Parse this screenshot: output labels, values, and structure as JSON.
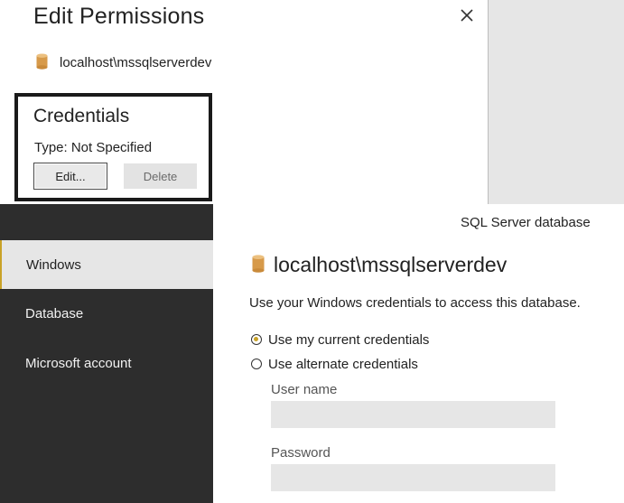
{
  "permissions_dialog": {
    "title": "Edit Permissions",
    "close_icon": "close-icon",
    "source_icon": "database-cylinder-icon",
    "source": "localhost\\mssqlserverdev",
    "credentials": {
      "heading": "Credentials",
      "type_text": "Type: Not Specified",
      "edit_label": "Edit...",
      "delete_label": "Delete"
    }
  },
  "credentials_dialog": {
    "connection_type": "SQL Server database",
    "source_icon": "database-cylinder-icon",
    "source": "localhost\\mssqlserverdev",
    "nav": [
      {
        "label": "Windows",
        "selected": true
      },
      {
        "label": "Database",
        "selected": false
      },
      {
        "label": "Microsoft account",
        "selected": false
      }
    ],
    "description": "Use your Windows credentials to access this database.",
    "options": [
      {
        "label": "Use my current credentials",
        "checked": true
      },
      {
        "label": "Use alternate credentials",
        "checked": false
      }
    ],
    "username_label": "User name",
    "username_value": "",
    "password_label": "Password",
    "password_value": ""
  },
  "colors": {
    "accent": "#c9a227",
    "sidebar_bg": "#2d2d2d",
    "selected_nav_bg": "#e6e6e6",
    "input_bg": "#e6e6e6"
  }
}
